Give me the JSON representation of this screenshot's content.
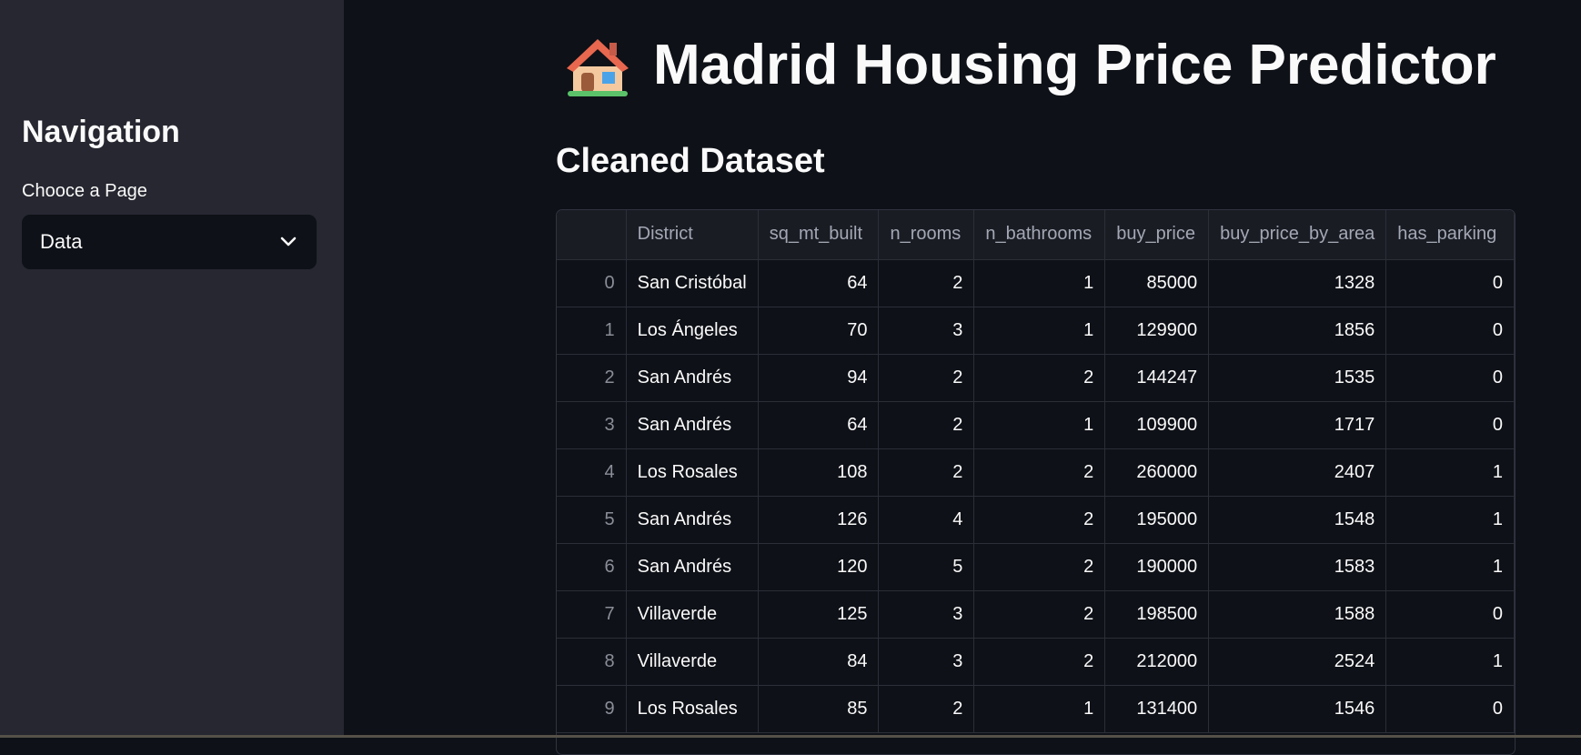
{
  "sidebar": {
    "title": "Navigation",
    "select_label": "Chooce a Page",
    "select_value": "Data"
  },
  "main": {
    "title": "Madrid Housing Price Predictor",
    "title_icon": "house-emoji-icon",
    "subheader": "Cleaned Dataset"
  },
  "table": {
    "columns": [
      "",
      "District",
      "sq_mt_built",
      "n_rooms",
      "n_bathrooms",
      "buy_price",
      "buy_price_by_area",
      "has_parking"
    ],
    "rows": [
      [
        "0",
        "San Cristóbal",
        "64",
        "2",
        "1",
        "85000",
        "1328",
        "0"
      ],
      [
        "1",
        "Los Ángeles",
        "70",
        "3",
        "1",
        "129900",
        "1856",
        "0"
      ],
      [
        "2",
        "San Andrés",
        "94",
        "2",
        "2",
        "144247",
        "1535",
        "0"
      ],
      [
        "3",
        "San Andrés",
        "64",
        "2",
        "1",
        "109900",
        "1717",
        "0"
      ],
      [
        "4",
        "Los Rosales",
        "108",
        "2",
        "2",
        "260000",
        "2407",
        "1"
      ],
      [
        "5",
        "San Andrés",
        "126",
        "4",
        "2",
        "195000",
        "1548",
        "1"
      ],
      [
        "6",
        "San Andrés",
        "120",
        "5",
        "2",
        "190000",
        "1583",
        "1"
      ],
      [
        "7",
        "Villaverde",
        "125",
        "3",
        "2",
        "198500",
        "1588",
        "0"
      ],
      [
        "8",
        "Villaverde",
        "84",
        "3",
        "2",
        "212000",
        "2524",
        "1"
      ],
      [
        "9",
        "Los Rosales",
        "85",
        "2",
        "1",
        "131400",
        "1546",
        "0"
      ]
    ]
  },
  "colors": {
    "sidebar_bg": "#262730",
    "main_bg": "#0e1117",
    "text": "#fafafa"
  }
}
